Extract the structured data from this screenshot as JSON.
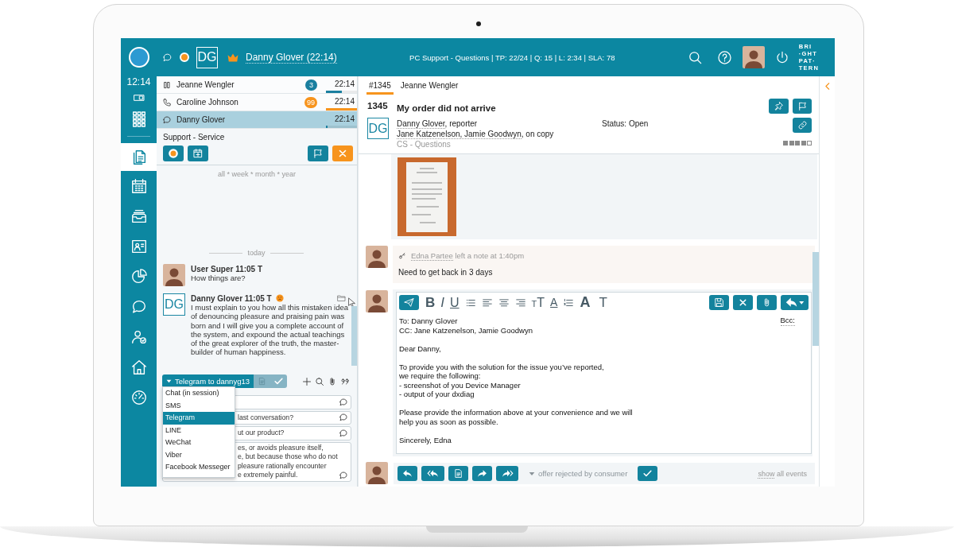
{
  "top_bar": {
    "initials": "DG",
    "contact": "Danny Glover (22:14)",
    "queue_info": "PC Support - Questions | TP: 22/24 | Q: 15 | L: 2:34 | SLA: 78",
    "logo_lines": [
      "BRI",
      "·GHT",
      "PAT·",
      "TERN"
    ]
  },
  "rail": {
    "clock": "12:14",
    "items": [
      {
        "selected": false
      },
      {
        "selected": false
      },
      {
        "selected": true
      },
      {
        "selected": false
      },
      {
        "selected": false
      },
      {
        "selected": false
      },
      {
        "selected": false
      },
      {
        "selected": false
      },
      {
        "selected": false
      },
      {
        "selected": false
      },
      {
        "selected": false
      }
    ]
  },
  "interactions": [
    {
      "kind": "hold",
      "name": "Jeanne Wengler",
      "badge": "3",
      "time": "22:14",
      "level": 0.5,
      "color": "#1a7f9f",
      "selected": false
    },
    {
      "kind": "call",
      "name": "Caroline Johnson",
      "badge": "99",
      "time": "22:14",
      "level": 1,
      "color": "#f7941d",
      "selected": false
    },
    {
      "kind": "chat",
      "name": "Danny Glover",
      "time": "22:14",
      "level": 0.05,
      "color": "#1a7f9f",
      "selected": true
    }
  ],
  "conversation": {
    "queue": "Support - Service",
    "period_filter": "all * week * month * year",
    "day_divider": "today",
    "messages": [
      {
        "kind": "photo",
        "author": "User Super",
        "time": "11:05 T",
        "text": "How things are?"
      },
      {
        "kind": "initials",
        "initials": "DG",
        "author": "Danny Glover",
        "time": "11:05 T",
        "negative_sentiment": true,
        "text": "I must explain to you how all this mistaken idea of denouncing pleasure and praising pain was born and I will give you a complete account of the system, and expound the actual teachings of the great explorer of the truth, the master-builder of human happiness."
      }
    ]
  },
  "composer": {
    "channel": "Telegram to dannyg13",
    "channel_menu": [
      {
        "label": "Chat (in session)",
        "selected": false
      },
      {
        "label": "SMS",
        "selected": false
      },
      {
        "label": "Telegram",
        "selected": true
      },
      {
        "label": "LINE",
        "selected": false
      },
      {
        "label": "WeChat",
        "selected": false
      },
      {
        "label": "Viber",
        "selected": false
      },
      {
        "label": "Facebook Messeger",
        "selected": false
      }
    ],
    "suggestions": [
      {
        "kind": "single"
      },
      {
        "kind": "single",
        "lines": [
          "last conversation?"
        ]
      },
      {
        "kind": "single",
        "lines": [
          "ut our product?"
        ]
      },
      {
        "kind": "multi",
        "lines": [
          "es, or avoids pleasure itself,",
          "e, but because those who do not",
          "pleasure rationally encounter",
          "e extremely painful."
        ]
      }
    ]
  },
  "ticket_tabs": [
    {
      "label": "#1345",
      "selected": true
    },
    {
      "label": "Jeanne Wengler",
      "selected": false
    }
  ],
  "ticket": {
    "number": "1345",
    "subject": "My order did not arrive",
    "initials": "DG",
    "reporter": "Danny Glover",
    "reporter_role": ", reporter",
    "status": "Status: Open",
    "cc": "Jane Katzenelson, Jamie Goodwyn",
    "cc_role": ", on copy",
    "category": "CS - Questions",
    "stars": 4
  },
  "note": {
    "author": "Edna Partee",
    "meta": "left a note at 1:40pm",
    "text": "Need to get back in 3 days"
  },
  "editor": {
    "format_tools": [
      {
        "kind": "bold",
        "label": "B"
      },
      {
        "kind": "italic",
        "label": "I"
      },
      {
        "kind": "underline",
        "label": "U"
      },
      {
        "kind": "bullets"
      },
      {
        "kind": "align_left"
      },
      {
        "kind": "align_center"
      },
      {
        "kind": "align_right"
      },
      {
        "kind": "font_size",
        "label": "TT"
      },
      {
        "kind": "font_color",
        "label": "A"
      },
      {
        "kind": "numbering"
      },
      {
        "kind": "font",
        "label": "A"
      },
      {
        "kind": "text",
        "label": "T"
      }
    ],
    "to": "To: Danny Glover",
    "bcc": "Bcc:",
    "cc": "CC: Jane Katzenelson, Jamie Goodwyn",
    "paragraphs": [
      [
        "Dear Danny,"
      ],
      [
        "To provide you with the solution for the issue you’ve reported,",
        "we require the following:",
        "- screenshot of you Device Manager",
        "- output of your dxdiag"
      ],
      [
        "Please provide the information above at your convenience and we will",
        "help you as soon as possible."
      ],
      [
        "Sincerely, Edna"
      ]
    ]
  },
  "action_bar": {
    "disposition": "offer rejected by consumer",
    "events_link": "show",
    "events_label": "all events"
  }
}
